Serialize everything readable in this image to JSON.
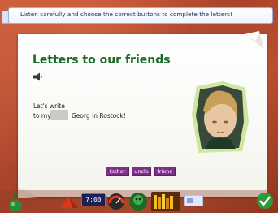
{
  "instruction": {
    "text": "Listen carefully and choose the correct buttons to complete the letters!"
  },
  "activity": {
    "title": "Letters to our friends",
    "line1": "Let's write",
    "line2_start": "to my",
    "line2_end": "Georg in Rostock!",
    "blank_value": ""
  },
  "choices": [
    {
      "label": "father"
    },
    {
      "label": "uncle"
    },
    {
      "label": "friend"
    }
  ],
  "toolbar": {
    "clock_text": "7:00",
    "items": [
      {
        "icon": "potion-bottle-icon"
      },
      {
        "icon": "red-cap-icon"
      },
      {
        "icon": "clock-icon"
      },
      {
        "icon": "dial-gauge-icon"
      },
      {
        "icon": "green-character-icon"
      },
      {
        "icon": "bookshelf-icon"
      },
      {
        "icon": "card-icon"
      },
      {
        "icon": "check-icon"
      }
    ]
  },
  "colors": {
    "title": "#1e6a2a",
    "choice_button": "#7e2f8e",
    "background": "#b24a2a"
  }
}
